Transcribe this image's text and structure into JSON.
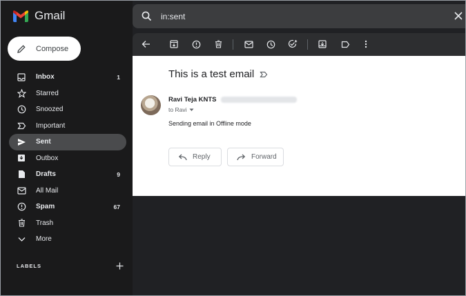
{
  "app": {
    "name": "Gmail"
  },
  "compose_label": "Compose",
  "nav": [
    {
      "label": "Inbox",
      "count": "1",
      "icon": "inbox-icon",
      "bold": true
    },
    {
      "label": "Starred",
      "count": "",
      "icon": "star-icon"
    },
    {
      "label": "Snoozed",
      "count": "",
      "icon": "clock-icon"
    },
    {
      "label": "Important",
      "count": "",
      "icon": "important-icon"
    },
    {
      "label": "Sent",
      "count": "",
      "icon": "send-icon",
      "active": true
    },
    {
      "label": "Outbox",
      "count": "",
      "icon": "outbox-icon"
    },
    {
      "label": "Drafts",
      "count": "9",
      "icon": "draft-icon",
      "bold": true
    },
    {
      "label": "All Mail",
      "count": "",
      "icon": "mail-icon"
    },
    {
      "label": "Spam",
      "count": "67",
      "icon": "spam-icon",
      "bold": true
    },
    {
      "label": "Trash",
      "count": "",
      "icon": "trash-icon"
    },
    {
      "label": "More",
      "count": "",
      "icon": "chevron-down-icon"
    }
  ],
  "labels_heading": "LABELS",
  "search": {
    "query": "in:sent"
  },
  "message": {
    "subject": "This is a test email",
    "sender_name": "Ravi Teja KNTS",
    "to_line": "to Ravi",
    "body": "Sending email in Offline mode"
  },
  "actions": {
    "reply": "Reply",
    "forward": "Forward"
  },
  "colors": {
    "sidebar_bg": "#1a1a1b",
    "active_item": "#4a4b4d",
    "search_bg": "#3c3d3f",
    "toolbar_bg": "#2d2e30"
  }
}
